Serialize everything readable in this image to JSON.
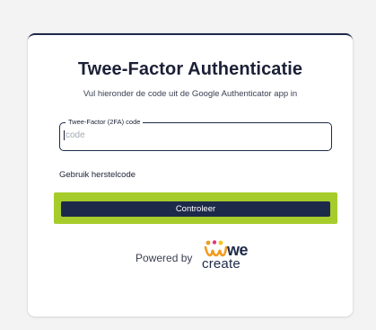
{
  "page": {
    "title": "Twee-Factor Authenticatie",
    "subtitle": "Vul hieronder de code uit de Google Authenticator app in"
  },
  "form": {
    "field_label": "Twee-Factor (2FA) code",
    "field_value": "",
    "field_placeholder": "code",
    "recovery_link": "Gebruik herstelcode",
    "verify_button": "Controleer"
  },
  "footer": {
    "powered_by": "Powered by",
    "logo_we": "we",
    "logo_create": "create"
  },
  "colors": {
    "primary": "#1e2a4a",
    "highlight": "#a6cc2b",
    "logo_orange": "#f29a1e",
    "logo_pink": "#e2337a",
    "logo_yellow": "#f5c518"
  },
  "icons": [
    "wecreate-logo-icon"
  ]
}
